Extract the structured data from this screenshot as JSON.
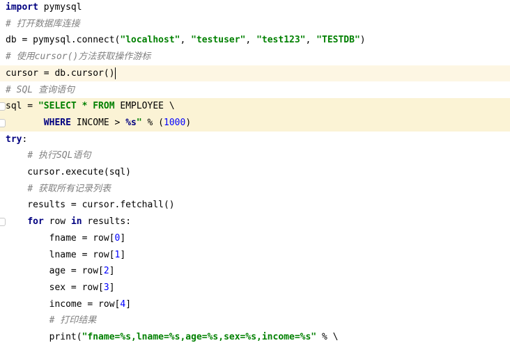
{
  "editor": {
    "lines": [
      {
        "t": [
          [
            "kw",
            "import"
          ],
          [
            "pl",
            " pymysql"
          ]
        ]
      },
      {
        "t": [
          [
            "cm",
            "# 打开数据库连接"
          ]
        ]
      },
      {
        "t": [
          [
            "pl",
            "db = pymysql.connect("
          ],
          [
            "str",
            "\"localhost\""
          ],
          [
            "pl",
            ", "
          ],
          [
            "str",
            "\"testuser\""
          ],
          [
            "pl",
            ", "
          ],
          [
            "str",
            "\"test123\""
          ],
          [
            "pl",
            ", "
          ],
          [
            "str",
            "\"TESTDB\""
          ],
          [
            "pl",
            ")"
          ]
        ]
      },
      {
        "t": [
          [
            "cm",
            "# 使用cursor()方法获取操作游标"
          ]
        ]
      },
      {
        "t": [
          [
            "pl",
            "cursor = db.cursor()"
          ]
        ],
        "hl": true,
        "caret": true
      },
      {
        "t": [
          [
            "cm",
            "# SQL 查询语句"
          ]
        ]
      },
      {
        "t": [
          [
            "pl",
            "sql = "
          ],
          [
            "str",
            "\"SELECT * FROM "
          ],
          [
            "pl",
            "EMPLOYEE \\"
          ]
        ],
        "sel": true,
        "gut": true
      },
      {
        "t": [
          [
            "pl",
            "       "
          ],
          [
            "kw",
            "WHERE"
          ],
          [
            "pl",
            " INCOME > "
          ],
          [
            "fmt",
            "%s"
          ],
          [
            "str",
            "\""
          ],
          [
            "pl",
            " % ("
          ],
          [
            "num",
            "1000"
          ],
          [
            "pl",
            ")"
          ]
        ],
        "sel": true,
        "gut": true
      },
      {
        "t": [
          [
            "kw",
            "try"
          ],
          [
            "pl",
            ":"
          ]
        ]
      },
      {
        "t": [
          [
            "pl",
            "    "
          ],
          [
            "cm",
            "# 执行SQL语句"
          ]
        ]
      },
      {
        "t": [
          [
            "pl",
            "    cursor.execute(sql)"
          ]
        ]
      },
      {
        "t": [
          [
            "pl",
            "    "
          ],
          [
            "cm",
            "# 获取所有记录列表"
          ]
        ]
      },
      {
        "t": [
          [
            "pl",
            "    results = cursor.fetchall()"
          ]
        ]
      },
      {
        "t": [
          [
            "pl",
            "    "
          ],
          [
            "kw",
            "for"
          ],
          [
            "pl",
            " row "
          ],
          [
            "kw",
            "in"
          ],
          [
            "pl",
            " results:"
          ]
        ],
        "gut": true
      },
      {
        "t": [
          [
            "pl",
            "        fname = row["
          ],
          [
            "num",
            "0"
          ],
          [
            "pl",
            "]"
          ]
        ]
      },
      {
        "t": [
          [
            "pl",
            "        lname = row["
          ],
          [
            "num",
            "1"
          ],
          [
            "pl",
            "]"
          ]
        ]
      },
      {
        "t": [
          [
            "pl",
            "        age = row["
          ],
          [
            "num",
            "2"
          ],
          [
            "pl",
            "]"
          ]
        ]
      },
      {
        "t": [
          [
            "pl",
            "        sex = row["
          ],
          [
            "num",
            "3"
          ],
          [
            "pl",
            "]"
          ]
        ]
      },
      {
        "t": [
          [
            "pl",
            "        income = row["
          ],
          [
            "num",
            "4"
          ],
          [
            "pl",
            "]"
          ]
        ]
      },
      {
        "t": [
          [
            "pl",
            "        "
          ],
          [
            "cm",
            "# 打印结果"
          ]
        ]
      },
      {
        "t": [
          [
            "pl",
            "        print("
          ],
          [
            "str",
            "\"fname=%s,lname=%s,age=%s,sex=%s,income=%s\""
          ],
          [
            "pl",
            " % \\"
          ]
        ]
      }
    ]
  }
}
